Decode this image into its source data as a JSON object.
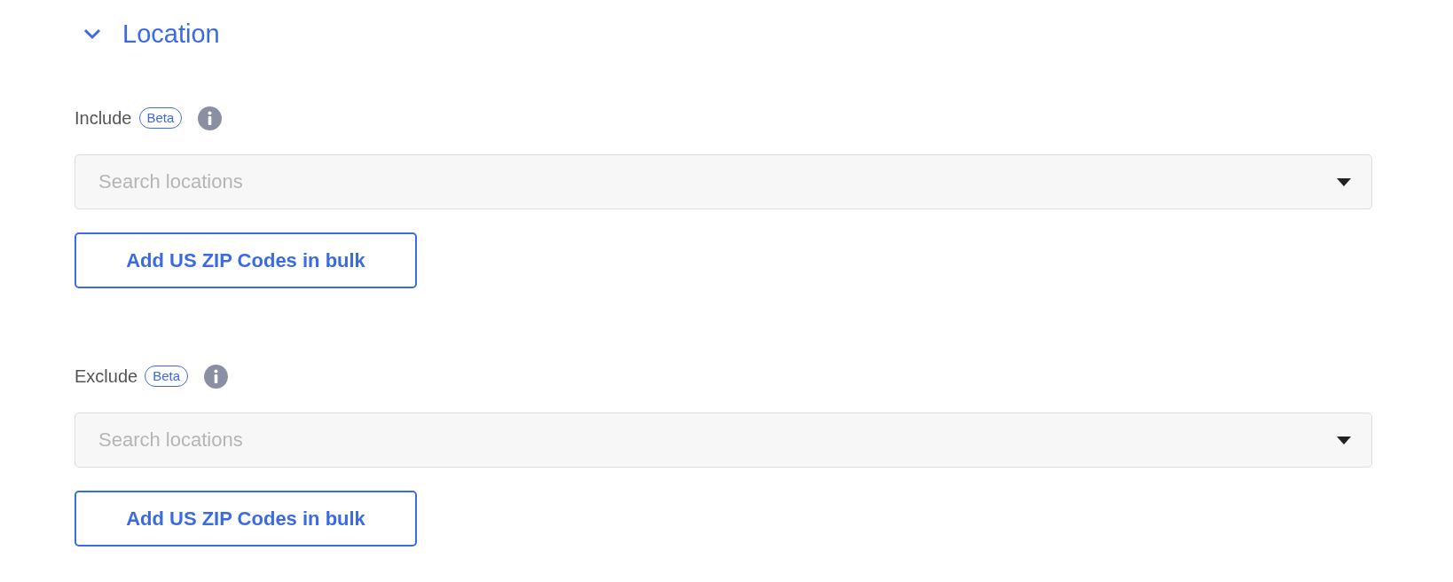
{
  "section": {
    "title": "Location",
    "expanded": true
  },
  "groups": [
    {
      "label": "Include",
      "badge": "Beta",
      "field": {
        "placeholder": "Search locations"
      },
      "button": "Add US ZIP Codes in bulk"
    },
    {
      "label": "Exclude",
      "badge": "Beta",
      "field": {
        "placeholder": "Search locations"
      },
      "button": "Add US ZIP Codes in bulk"
    }
  ]
}
